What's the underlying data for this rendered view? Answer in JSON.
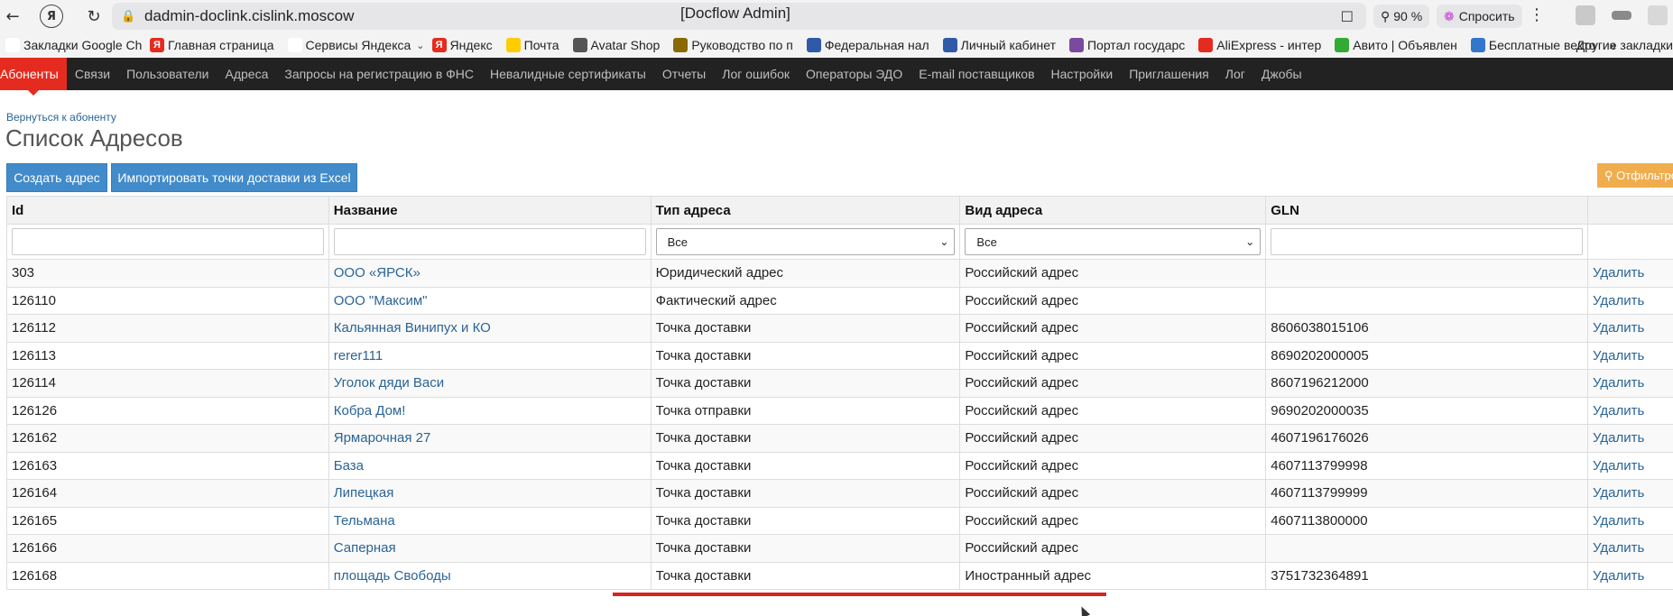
{
  "browser": {
    "url": "dadmin-doclink.cislink.moscow",
    "tab_title": "[Docflow Admin]",
    "zoom": "90 %",
    "ask_label": "Спросить"
  },
  "bookmarks": {
    "items": [
      {
        "label": "Закладки Google Ch",
        "icon": "folder",
        "color": "#ffffff",
        "has_chevron": true
      },
      {
        "label": "Главная страница",
        "icon": "yandex-y",
        "color": "#e52b1f",
        "has_chevron": false
      },
      {
        "label": "Сервисы Яндекса",
        "icon": "grid",
        "color": "#ffffff",
        "has_chevron": true
      },
      {
        "label": "Яндекс",
        "icon": "yandex-y",
        "color": "#e52b1f",
        "has_chevron": false
      },
      {
        "label": "Почта",
        "icon": "mail",
        "color": "#ffcc00",
        "has_chevron": false
      },
      {
        "label": "Avatar Shop",
        "icon": "shop",
        "color": "#555555",
        "has_chevron": false
      },
      {
        "label": "Руководство по п",
        "icon": "gear",
        "color": "#8a6a00",
        "has_chevron": false
      },
      {
        "label": "Федеральная нал",
        "icon": "emblem",
        "color": "#2f5aa8",
        "has_chevron": false
      },
      {
        "label": "Личный кабинет",
        "icon": "emblem",
        "color": "#2f5aa8",
        "has_chevron": false
      },
      {
        "label": "Портал государс",
        "icon": "gos",
        "color": "#7a4aa0",
        "has_chevron": false
      },
      {
        "label": "AliExpress - интер",
        "icon": "ali",
        "color": "#e52b1f",
        "has_chevron": false
      },
      {
        "label": "Авито | Объявлен",
        "icon": "avito",
        "color": "#33aa33",
        "has_chevron": false
      },
      {
        "label": "Бесплатные векто",
        "icon": "vector",
        "color": "#3377cc",
        "has_chevron": false
      }
    ],
    "more": "»",
    "other": "Другие закладки"
  },
  "nav": {
    "items": [
      {
        "label": "Абоненты",
        "active": true
      },
      {
        "label": "Связи",
        "active": false
      },
      {
        "label": "Пользователи",
        "active": false
      },
      {
        "label": "Адреса",
        "active": false
      },
      {
        "label": "Запросы на регистрацию в ФНС",
        "active": false
      },
      {
        "label": "Невалидные сертификаты",
        "active": false
      },
      {
        "label": "Отчеты",
        "active": false
      },
      {
        "label": "Лог ошибок",
        "active": false
      },
      {
        "label": "Операторы ЭДО",
        "active": false
      },
      {
        "label": "E-mail поставщиков",
        "active": false
      },
      {
        "label": "Настройки",
        "active": false
      },
      {
        "label": "Приглашения",
        "active": false
      },
      {
        "label": "Лог",
        "active": false
      },
      {
        "label": "Джобы",
        "active": false
      }
    ],
    "accent": "#e52b1f"
  },
  "page": {
    "back_link": "Вернуться к абоненту",
    "title": "Список Адресов",
    "create_button": "Создать адрес",
    "import_button": "Импортировать точки доставки из Excel",
    "filter_button": "Отфильтровать"
  },
  "table": {
    "columns": [
      "Id",
      "Название",
      "Тип адреса",
      "Вид адреса",
      "GLN",
      ""
    ],
    "filters": {
      "type_selected": "Все",
      "kind_selected": "Все"
    },
    "delete_label": "Удалить",
    "rows": [
      {
        "id": "303",
        "name": "ООО «ЯРСК»",
        "type": "Юридический адрес",
        "kind": "Российский адрес",
        "gln": ""
      },
      {
        "id": "126110",
        "name": "ООО \"Максим\"",
        "type": "Фактический адрес",
        "kind": "Российский адрес",
        "gln": ""
      },
      {
        "id": "126112",
        "name": "Кальянная Винипух и КО",
        "type": "Точка доставки",
        "kind": "Российский адрес",
        "gln": "8606038015106"
      },
      {
        "id": "126113",
        "name": "rerer111",
        "type": "Точка доставки",
        "kind": "Российский адрес",
        "gln": "8690202000005"
      },
      {
        "id": "126114",
        "name": "Уголок дяди Васи",
        "type": "Точка доставки",
        "kind": "Российский адрес",
        "gln": "8607196212000"
      },
      {
        "id": "126126",
        "name": "Кобра Дом!",
        "type": "Точка отправки",
        "kind": "Российский адрес",
        "gln": "9690202000035"
      },
      {
        "id": "126162",
        "name": "Ярмарочная 27",
        "type": "Точка доставки",
        "kind": "Российский адрес",
        "gln": "4607196176026"
      },
      {
        "id": "126163",
        "name": "База",
        "type": "Точка доставки",
        "kind": "Российский адрес",
        "gln": "4607113799998"
      },
      {
        "id": "126164",
        "name": "Липецкая",
        "type": "Точка доставки",
        "kind": "Российский адрес",
        "gln": "4607113799999"
      },
      {
        "id": "126165",
        "name": "Тельмана",
        "type": "Точка доставки",
        "kind": "Российский адрес",
        "gln": "4607113800000"
      },
      {
        "id": "126166",
        "name": "Саперная",
        "type": "Точка доставки",
        "kind": "Российский адрес",
        "gln": ""
      },
      {
        "id": "126168",
        "name": "площадь Свободы",
        "type": "Точка доставки",
        "kind": "Иностранный адрес",
        "gln": "3751732364891"
      }
    ]
  }
}
